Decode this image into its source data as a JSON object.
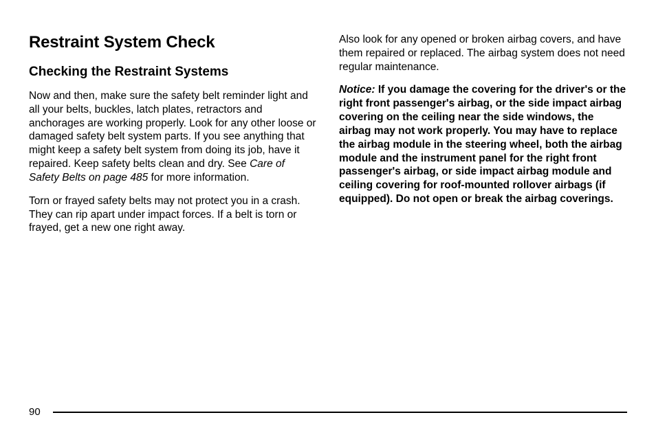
{
  "heading_main": "Restraint System Check",
  "heading_sub": "Checking the Restraint Systems",
  "left_para1_pre": "Now and then, make sure the safety belt reminder light and all your belts, buckles, latch plates, retractors and anchorages are working properly. Look for any other loose or damaged safety belt system parts. If you see anything that might keep a safety belt system from doing its job, have it repaired. Keep safety belts clean and dry. See ",
  "left_para1_ref": "Care of Safety Belts on page 485",
  "left_para1_post": " for more information.",
  "left_para2": "Torn or frayed safety belts may not protect you in a crash. They can rip apart under impact forces. If a belt is torn or frayed, get a new one right away.",
  "right_para1": "Also look for any opened or broken airbag covers, and have them repaired or replaced. The airbag system does not need regular maintenance.",
  "notice_label": "Notice:",
  "notice_body": "   If you damage the covering for the driver's or the right front passenger's airbag, or the side impact airbag covering on the ceiling near the side windows, the airbag may not work properly. You may have to replace the airbag module in the steering wheel, both the airbag module and the instrument panel for the right front passenger's airbag, or side impact airbag module and ceiling covering for roof-mounted rollover airbags (if equipped). Do not open or break the airbag coverings.",
  "page_number": "90"
}
